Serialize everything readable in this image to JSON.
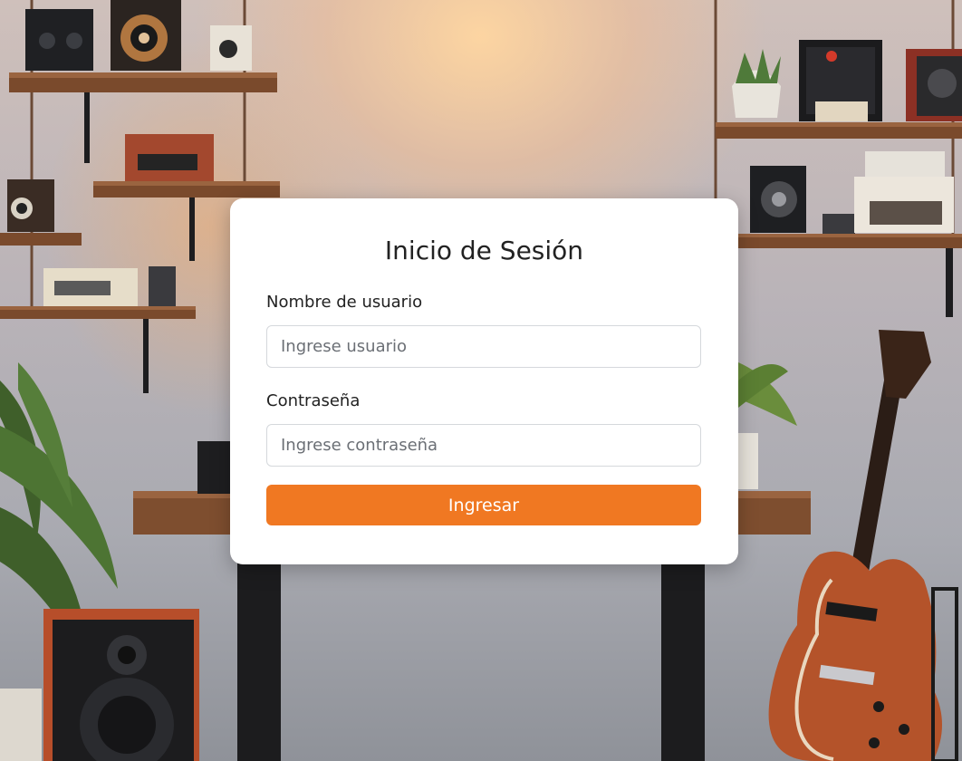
{
  "login": {
    "title": "Inicio de Sesión",
    "username_label": "Nombre de usuario",
    "username_placeholder": "Ingrese usuario",
    "username_value": "",
    "password_label": "Contraseña",
    "password_placeholder": "Ingrese contraseña",
    "password_value": "",
    "submit_label": "Ingresar"
  },
  "colors": {
    "accent": "#f07822",
    "card_background": "#ffffff",
    "input_border": "#d5d8dc"
  },
  "background": {
    "description_icons": [
      "shelf-icon",
      "speaker-icon",
      "plant-icon",
      "guitar-icon",
      "desk-icon"
    ]
  }
}
